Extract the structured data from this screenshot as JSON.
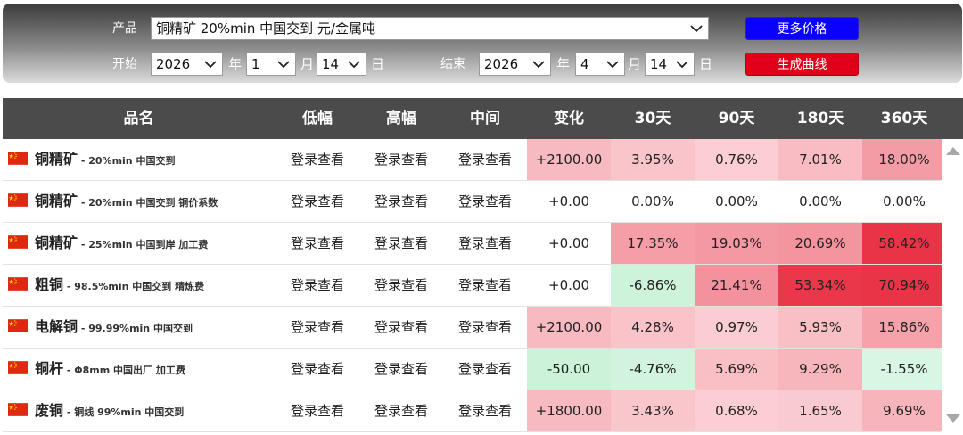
{
  "form": {
    "product_label": "产品",
    "product_value": "铜精矿 20%min 中国交到 元/金属吨",
    "start_label": "开始",
    "start_year": "2026",
    "start_month": "1",
    "start_day": "14",
    "end_label": "结束",
    "end_year": "2026",
    "end_month": "4",
    "end_day": "14",
    "year_unit": "年",
    "month_unit": "月",
    "day_unit": "日",
    "more_prices_label": "更多价格",
    "generate_curve_label": "生成曲线"
  },
  "table": {
    "headers": [
      "品名",
      "低幅",
      "高幅",
      "中间",
      "变化",
      "30天",
      "90天",
      "180天",
      "360天"
    ],
    "rows": [
      {
        "name": "铜精矿",
        "desc": "20%min 中国交到",
        "low": "登录查看",
        "high": "登录查看",
        "mid": "登录查看",
        "change": "+2100.00",
        "d30": "3.95%",
        "d90": "0.76%",
        "d180": "7.01%",
        "d360": "18.00%"
      },
      {
        "name": "铜精矿",
        "desc": "20%min 中国交到 铜价系数",
        "low": "登录查看",
        "high": "登录查看",
        "mid": "登录查看",
        "change": "+0.00",
        "d30": "0.00%",
        "d90": "0.00%",
        "d180": "0.00%",
        "d360": "0.00%"
      },
      {
        "name": "铜精矿",
        "desc": "25%min 中国到岸 加工费",
        "low": "登录查看",
        "high": "登录查看",
        "mid": "登录查看",
        "change": "+0.00",
        "d30": "17.35%",
        "d90": "19.03%",
        "d180": "20.69%",
        "d360": "58.42%"
      },
      {
        "name": "粗铜",
        "desc": "98.5%min 中国交到 精炼费",
        "low": "登录查看",
        "high": "登录查看",
        "mid": "登录查看",
        "change": "+0.00",
        "d30": "-6.86%",
        "d90": "21.41%",
        "d180": "53.34%",
        "d360": "70.94%"
      },
      {
        "name": "电解铜",
        "desc": "99.99%min 中国交到",
        "low": "登录查看",
        "high": "登录查看",
        "mid": "登录查看",
        "change": "+2100.00",
        "d30": "4.28%",
        "d90": "0.97%",
        "d180": "5.93%",
        "d360": "15.86%"
      },
      {
        "name": "铜杆",
        "desc": "Φ8mm 中国出厂 加工费",
        "low": "登录查看",
        "high": "登录查看",
        "mid": "登录查看",
        "change": "-50.00",
        "d30": "-4.76%",
        "d90": "5.69%",
        "d180": "9.29%",
        "d360": "-1.55%"
      },
      {
        "name": "废铜",
        "desc": "铜线 99%min 中国交到",
        "low": "登录查看",
        "high": "登录查看",
        "mid": "登录查看",
        "change": "+1800.00",
        "d30": "3.43%",
        "d90": "0.68%",
        "d180": "1.65%",
        "d360": "9.69%"
      }
    ]
  },
  "colors": {
    "button_more": "#0a00ff",
    "button_curve": "#e0001a",
    "header_bg": "#4b4b4b",
    "heat_up": "#e8283c",
    "heat_down": "#5fd98a"
  }
}
